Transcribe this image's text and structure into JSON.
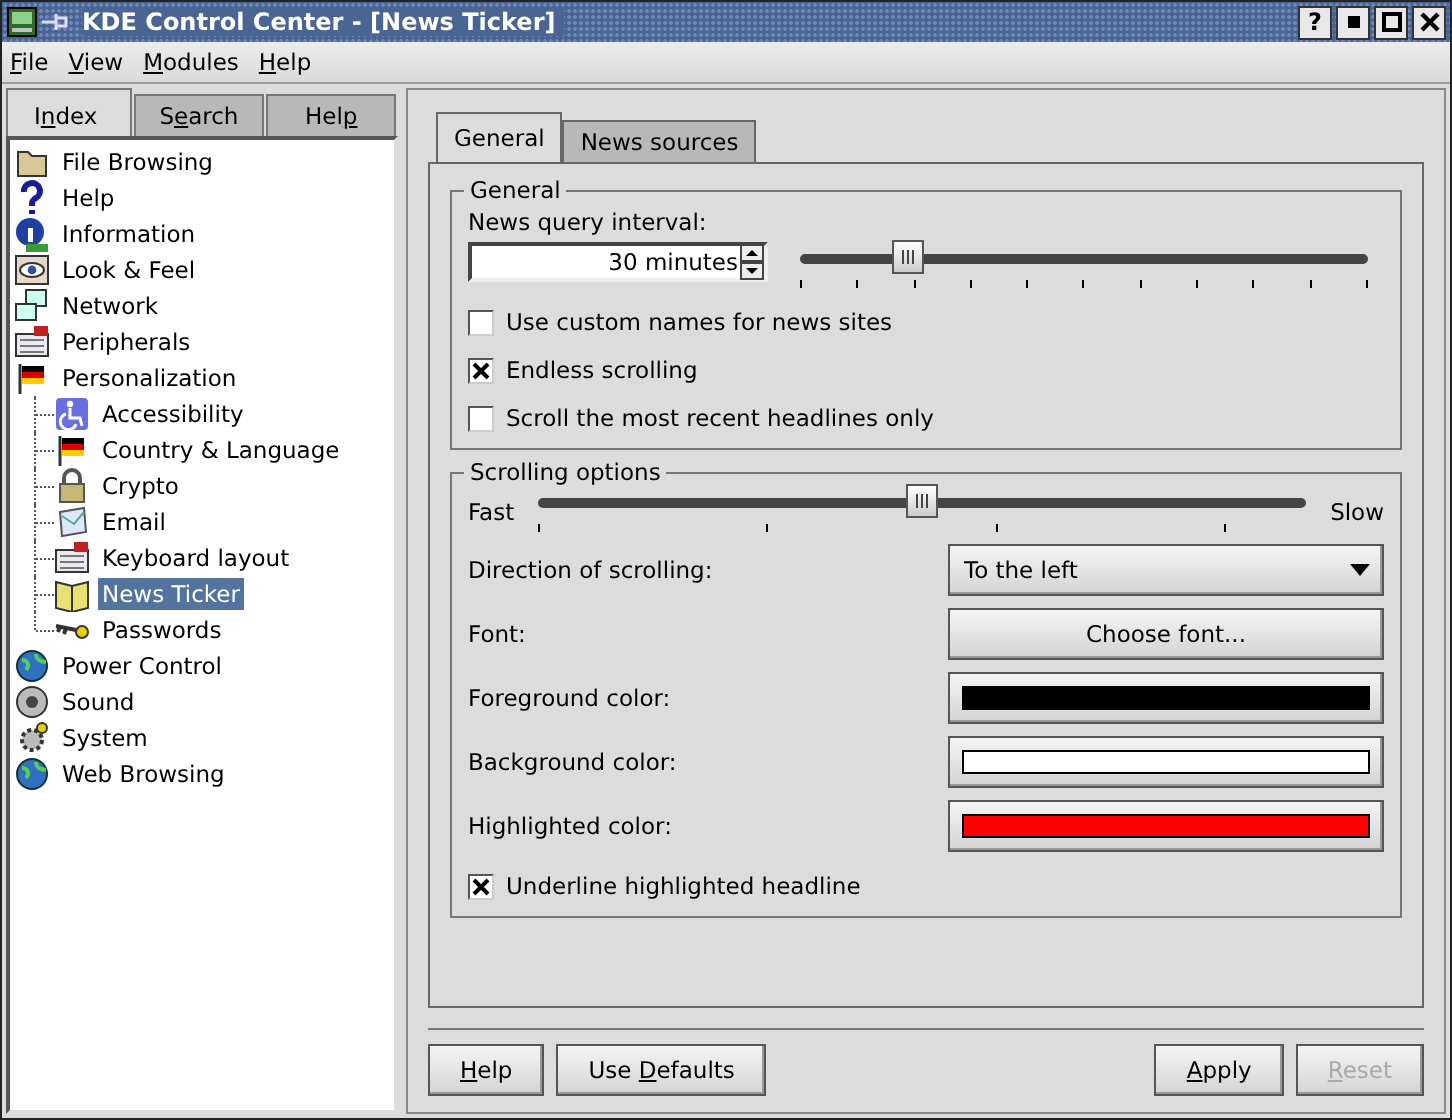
{
  "window": {
    "title": "KDE Control Center - [News Ticker]",
    "help_button": "?"
  },
  "menu": [
    {
      "label": {
        "key": "F",
        "after": "ile"
      }
    },
    {
      "label": {
        "key": "V",
        "after": "iew"
      }
    },
    {
      "label": {
        "key": "M",
        "after": "odules"
      }
    },
    {
      "label": {
        "key": "H",
        "after": "elp"
      }
    }
  ],
  "sidebar": {
    "tabs": [
      {
        "label": {
          "before": "I",
          "key": "n",
          "after": "dex"
        },
        "selected": true
      },
      {
        "label": {
          "before": "S",
          "key": "e",
          "after": "arch"
        },
        "selected": false
      },
      {
        "label": {
          "before": "Hel",
          "key": "p"
        },
        "selected": false
      }
    ],
    "tree": [
      {
        "label": "File Browsing",
        "selected": false
      },
      {
        "label": "Help",
        "selected": false
      },
      {
        "label": "Information",
        "selected": false
      },
      {
        "label": "Look & Feel",
        "selected": false
      },
      {
        "label": "Network",
        "selected": false
      },
      {
        "label": "Peripherals",
        "selected": false
      },
      {
        "label": "Personalization",
        "selected": false,
        "expanded": true,
        "children": [
          {
            "label": "Accessibility",
            "selected": false
          },
          {
            "label": "Country & Language",
            "selected": false
          },
          {
            "label": "Crypto",
            "selected": false
          },
          {
            "label": "Email",
            "selected": false
          },
          {
            "label": "Keyboard layout",
            "selected": false
          },
          {
            "label": "News Ticker",
            "selected": true
          },
          {
            "label": "Passwords",
            "selected": false
          }
        ]
      },
      {
        "label": "Power Control",
        "selected": false
      },
      {
        "label": "Sound",
        "selected": false
      },
      {
        "label": "System",
        "selected": false
      },
      {
        "label": "Web Browsing",
        "selected": false
      }
    ]
  },
  "module": {
    "tabs": [
      {
        "label": "General",
        "selected": true
      },
      {
        "label": "News sources",
        "selected": false
      }
    ],
    "general": {
      "title": "General",
      "interval_label": "News query interval:",
      "interval_value": "30 minutes",
      "interval_slider": {
        "level": 0.19
      },
      "checkboxes": [
        {
          "label": "Use custom names for news sites",
          "checked": false
        },
        {
          "label": "Endless scrolling",
          "checked": true
        },
        {
          "label": "Scroll the most recent headlines only",
          "checked": false
        }
      ]
    },
    "scrolling": {
      "title": "Scrolling options",
      "speed_min": "Fast",
      "speed_max": "Slow",
      "speed_slider": {
        "level": 0.5
      },
      "rows": [
        {
          "kind": "dropdown",
          "label": "Direction of scrolling:",
          "value": "To the left"
        },
        {
          "kind": "button",
          "label": "Font:",
          "value": "Choose font..."
        },
        {
          "kind": "color",
          "label": "Foreground color:",
          "color": "#000000"
        },
        {
          "kind": "color",
          "label": "Background color:",
          "color": "#ffffff"
        },
        {
          "kind": "color",
          "label": "Highlighted color:",
          "color": "#ff0000"
        }
      ],
      "checkboxes": [
        {
          "label": "Underline highlighted headline",
          "checked": true
        }
      ]
    }
  },
  "buttons_left": [
    {
      "label": {
        "key": "H",
        "after": "elp"
      },
      "disabled": false
    },
    {
      "label": {
        "before": "Use ",
        "key": "D",
        "after": "efaults"
      },
      "disabled": false
    }
  ],
  "buttons_right": [
    {
      "label": {
        "key": "A",
        "after": "pply"
      },
      "disabled": false
    },
    {
      "label": {
        "key": "R",
        "after": "eset"
      },
      "disabled": true
    }
  ]
}
